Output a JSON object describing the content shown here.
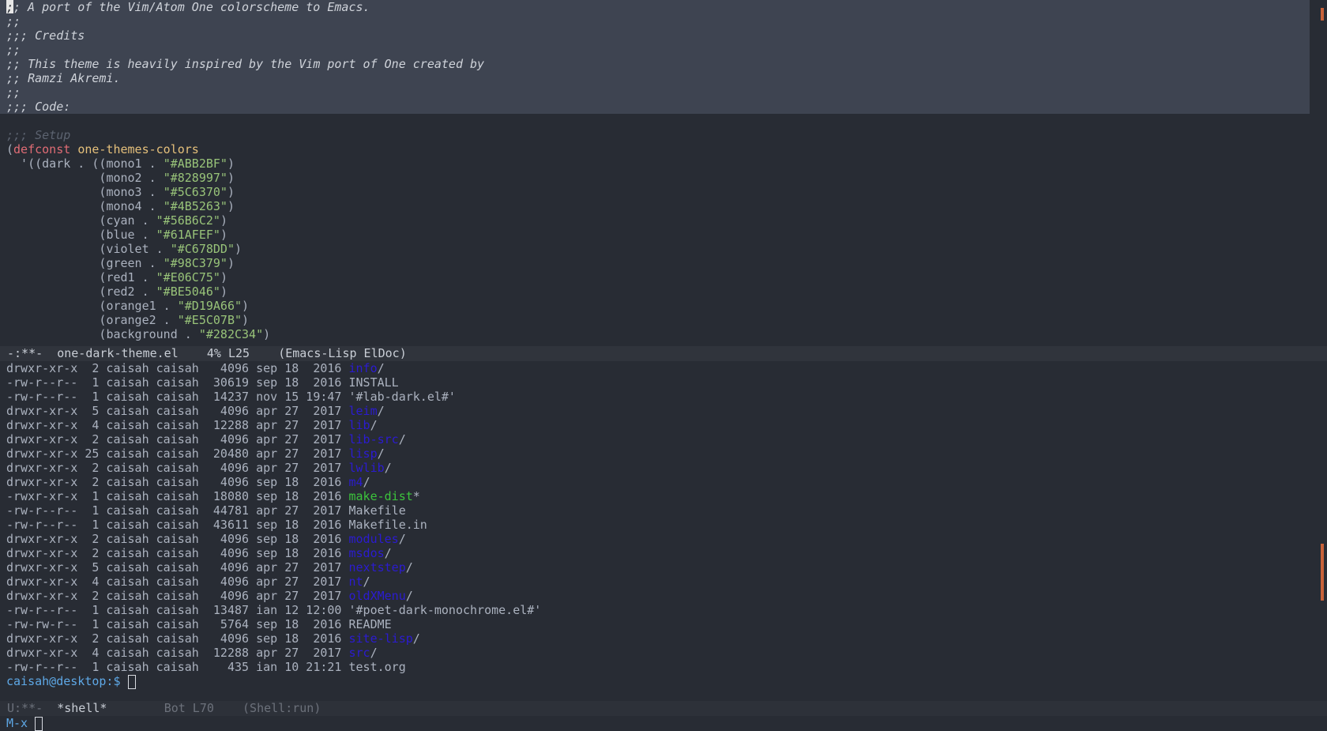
{
  "top_buffer": {
    "lines": [
      {
        "text": ";; A port of the Vim/Atom One colorscheme to Emacs.",
        "cursor_char": ";"
      },
      {
        "text": ";;"
      },
      {
        "text": ";;; Credits"
      },
      {
        "text": ";;"
      },
      {
        "text": ";; This theme is heavily inspired by the Vim port of One created by"
      },
      {
        "text": ";; Ramzi Akremi."
      },
      {
        "text": ";;"
      },
      {
        "text": ";;; Code:"
      }
    ],
    "setup_comment": ";;; Setup",
    "defconst": {
      "open": "(",
      "keyword": "defconst",
      "name": "one-themes-colors"
    },
    "dark_open": "  '((dark . ((",
    "colors": [
      {
        "name": "mono1",
        "value": "\"#ABB2BF\""
      },
      {
        "name": "mono2",
        "value": "\"#828997\""
      },
      {
        "name": "mono3",
        "value": "\"#5C6370\""
      },
      {
        "name": "mono4",
        "value": "\"#4B5263\""
      },
      {
        "name": "cyan",
        "value": "\"#56B6C2\""
      },
      {
        "name": "blue",
        "value": "\"#61AFEF\""
      },
      {
        "name": "violet",
        "value": "\"#C678DD\""
      },
      {
        "name": "green",
        "value": "\"#98C379\""
      },
      {
        "name": "red1",
        "value": "\"#E06C75\""
      },
      {
        "name": "red2",
        "value": "\"#BE5046\""
      },
      {
        "name": "orange1",
        "value": "\"#D19A66\""
      },
      {
        "name": "orange2",
        "value": "\"#E5C07B\""
      },
      {
        "name": "background",
        "value": "\"#282C34\""
      }
    ]
  },
  "modeline_top": {
    "status": "-:**-",
    "buffer": "one-dark-theme.el",
    "position": "4% L25",
    "modes": "(Emacs-Lisp ElDoc)"
  },
  "shell": {
    "listing": [
      {
        "perms": "drwxr-xr-x",
        "links": "2",
        "owner": "caisah",
        "group": "caisah",
        "size": "4096",
        "date": "sep 18  2016",
        "name": "info",
        "suffix": "/",
        "kind": "dir"
      },
      {
        "perms": "-rw-r--r--",
        "links": "1",
        "owner": "caisah",
        "group": "caisah",
        "size": "30619",
        "date": "sep 18  2016",
        "name": "INSTALL",
        "suffix": "",
        "kind": "file"
      },
      {
        "perms": "-rw-r--r--",
        "links": "1",
        "owner": "caisah",
        "group": "caisah",
        "size": "14237",
        "date": "nov 15 19:47",
        "name": "'#lab-dark.el#'",
        "suffix": "",
        "kind": "file"
      },
      {
        "perms": "drwxr-xr-x",
        "links": "5",
        "owner": "caisah",
        "group": "caisah",
        "size": "4096",
        "date": "apr 27  2017",
        "name": "leim",
        "suffix": "/",
        "kind": "dir"
      },
      {
        "perms": "drwxr-xr-x",
        "links": "4",
        "owner": "caisah",
        "group": "caisah",
        "size": "12288",
        "date": "apr 27  2017",
        "name": "lib",
        "suffix": "/",
        "kind": "dir"
      },
      {
        "perms": "drwxr-xr-x",
        "links": "2",
        "owner": "caisah",
        "group": "caisah",
        "size": "4096",
        "date": "apr 27  2017",
        "name": "lib-src",
        "suffix": "/",
        "kind": "dir"
      },
      {
        "perms": "drwxr-xr-x",
        "links": "25",
        "owner": "caisah",
        "group": "caisah",
        "size": "20480",
        "date": "apr 27  2017",
        "name": "lisp",
        "suffix": "/",
        "kind": "dir"
      },
      {
        "perms": "drwxr-xr-x",
        "links": "2",
        "owner": "caisah",
        "group": "caisah",
        "size": "4096",
        "date": "apr 27  2017",
        "name": "lwlib",
        "suffix": "/",
        "kind": "dir"
      },
      {
        "perms": "drwxr-xr-x",
        "links": "2",
        "owner": "caisah",
        "group": "caisah",
        "size": "4096",
        "date": "sep 18  2016",
        "name": "m4",
        "suffix": "/",
        "kind": "dir"
      },
      {
        "perms": "-rwxr-xr-x",
        "links": "1",
        "owner": "caisah",
        "group": "caisah",
        "size": "18080",
        "date": "sep 18  2016",
        "name": "make-dist",
        "suffix": "*",
        "kind": "exe"
      },
      {
        "perms": "-rw-r--r--",
        "links": "1",
        "owner": "caisah",
        "group": "caisah",
        "size": "44781",
        "date": "apr 27  2017",
        "name": "Makefile",
        "suffix": "",
        "kind": "file"
      },
      {
        "perms": "-rw-r--r--",
        "links": "1",
        "owner": "caisah",
        "group": "caisah",
        "size": "43611",
        "date": "sep 18  2016",
        "name": "Makefile.in",
        "suffix": "",
        "kind": "file"
      },
      {
        "perms": "drwxr-xr-x",
        "links": "2",
        "owner": "caisah",
        "group": "caisah",
        "size": "4096",
        "date": "sep 18  2016",
        "name": "modules",
        "suffix": "/",
        "kind": "dir"
      },
      {
        "perms": "drwxr-xr-x",
        "links": "2",
        "owner": "caisah",
        "group": "caisah",
        "size": "4096",
        "date": "sep 18  2016",
        "name": "msdos",
        "suffix": "/",
        "kind": "dir"
      },
      {
        "perms": "drwxr-xr-x",
        "links": "5",
        "owner": "caisah",
        "group": "caisah",
        "size": "4096",
        "date": "apr 27  2017",
        "name": "nextstep",
        "suffix": "/",
        "kind": "dir"
      },
      {
        "perms": "drwxr-xr-x",
        "links": "4",
        "owner": "caisah",
        "group": "caisah",
        "size": "4096",
        "date": "apr 27  2017",
        "name": "nt",
        "suffix": "/",
        "kind": "dir"
      },
      {
        "perms": "drwxr-xr-x",
        "links": "2",
        "owner": "caisah",
        "group": "caisah",
        "size": "4096",
        "date": "apr 27  2017",
        "name": "oldXMenu",
        "suffix": "/",
        "kind": "dir"
      },
      {
        "perms": "-rw-r--r--",
        "links": "1",
        "owner": "caisah",
        "group": "caisah",
        "size": "13487",
        "date": "ian 12 12:00",
        "name": "'#poet-dark-monochrome.el#'",
        "suffix": "",
        "kind": "file"
      },
      {
        "perms": "-rw-rw-r--",
        "links": "1",
        "owner": "caisah",
        "group": "caisah",
        "size": "5764",
        "date": "sep 18  2016",
        "name": "README",
        "suffix": "",
        "kind": "file"
      },
      {
        "perms": "drwxr-xr-x",
        "links": "2",
        "owner": "caisah",
        "group": "caisah",
        "size": "4096",
        "date": "sep 18  2016",
        "name": "site-lisp",
        "suffix": "/",
        "kind": "dir"
      },
      {
        "perms": "drwxr-xr-x",
        "links": "4",
        "owner": "caisah",
        "group": "caisah",
        "size": "12288",
        "date": "apr 27  2017",
        "name": "src",
        "suffix": "/",
        "kind": "dir"
      },
      {
        "perms": "-rw-r--r--",
        "links": "1",
        "owner": "caisah",
        "group": "caisah",
        "size": "435",
        "date": "ian 10 21:21",
        "name": "test.org",
        "suffix": "",
        "kind": "file"
      }
    ],
    "prompt": "caisah@desktop:$"
  },
  "modeline_bottom": {
    "status": "U:**-",
    "buffer": "*shell*",
    "position": "Bot L70",
    "modes": "(Shell:run)"
  },
  "minibuffer": {
    "label": "M-x"
  },
  "scrollbar": {
    "color": "#c8623a"
  },
  "colors": {
    "background": "#282c34",
    "region_highlight": "#3e4451",
    "keyword": "#e06c75",
    "function_name": "#e5c07b",
    "string": "#98c379",
    "directory": "#2b1bd1",
    "executable": "#3cc43c",
    "prompt": "#5ea8e6"
  }
}
